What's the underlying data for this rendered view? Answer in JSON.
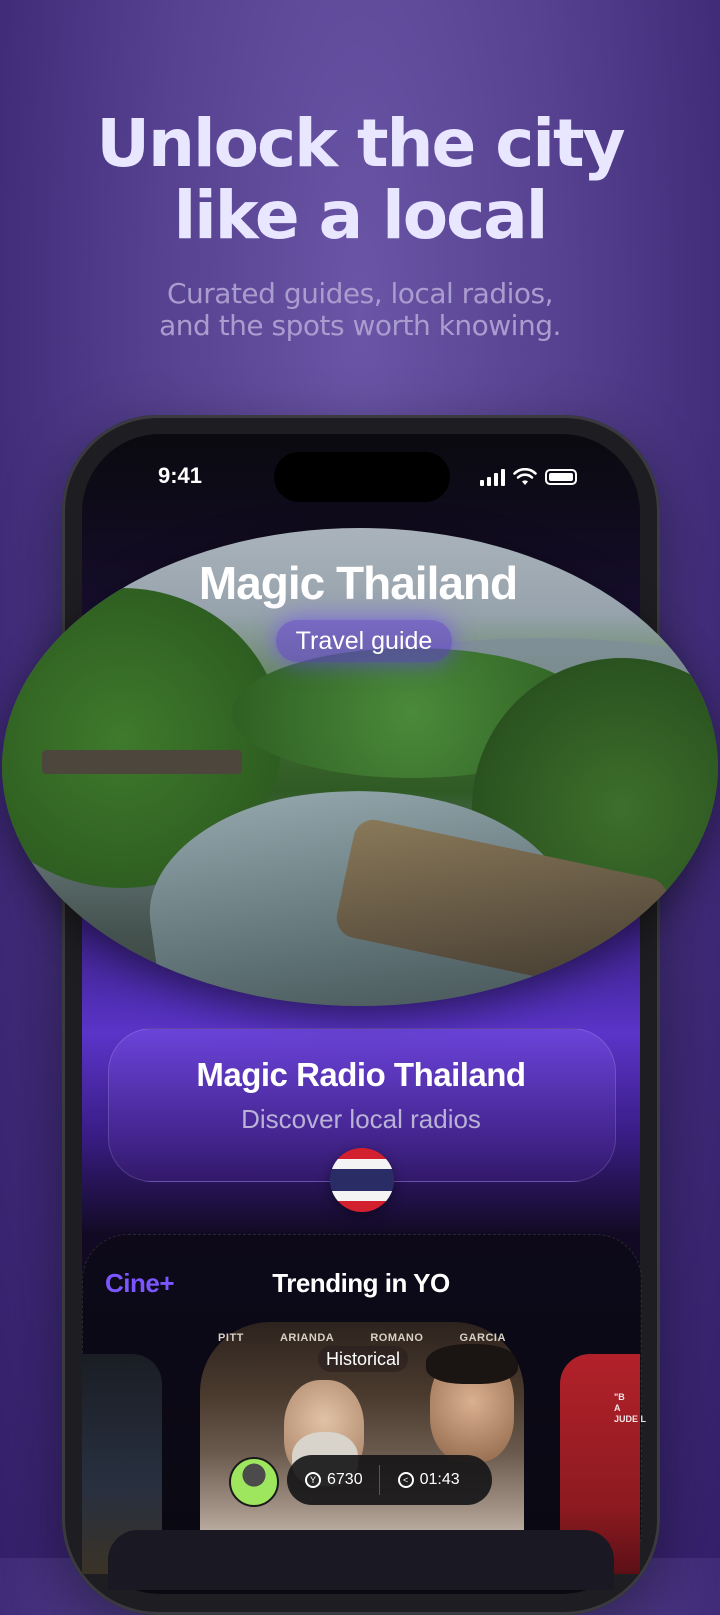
{
  "hero": {
    "headline_line1": "Unlock the city",
    "headline_line2": "like a local",
    "sub_line1": "Curated guides, local radios,",
    "sub_line2": "and the spots worth knowing."
  },
  "status_bar": {
    "time": "9:41",
    "icons": [
      "cellular-signal-icon",
      "wifi-icon",
      "battery-icon"
    ]
  },
  "guide_card": {
    "title": "Magic Thailand",
    "tag": "Travel guide"
  },
  "radio_card": {
    "title": "Magic Radio Thailand",
    "subtitle": "Discover local radios",
    "flag_icon": "thailand-flag-icon"
  },
  "trending": {
    "brand": "Cine+",
    "title": "Trending in YO",
    "poster": {
      "names": [
        "PITT",
        "ARIANDA",
        "ROMANO",
        "GARCIA"
      ],
      "genre": "Historical",
      "views": "6730",
      "duration": "01:43"
    },
    "side_poster_text": "\"B\nA\nJUDE L"
  },
  "colors": {
    "accent": "#7b56ff",
    "background": "#4a3686"
  }
}
